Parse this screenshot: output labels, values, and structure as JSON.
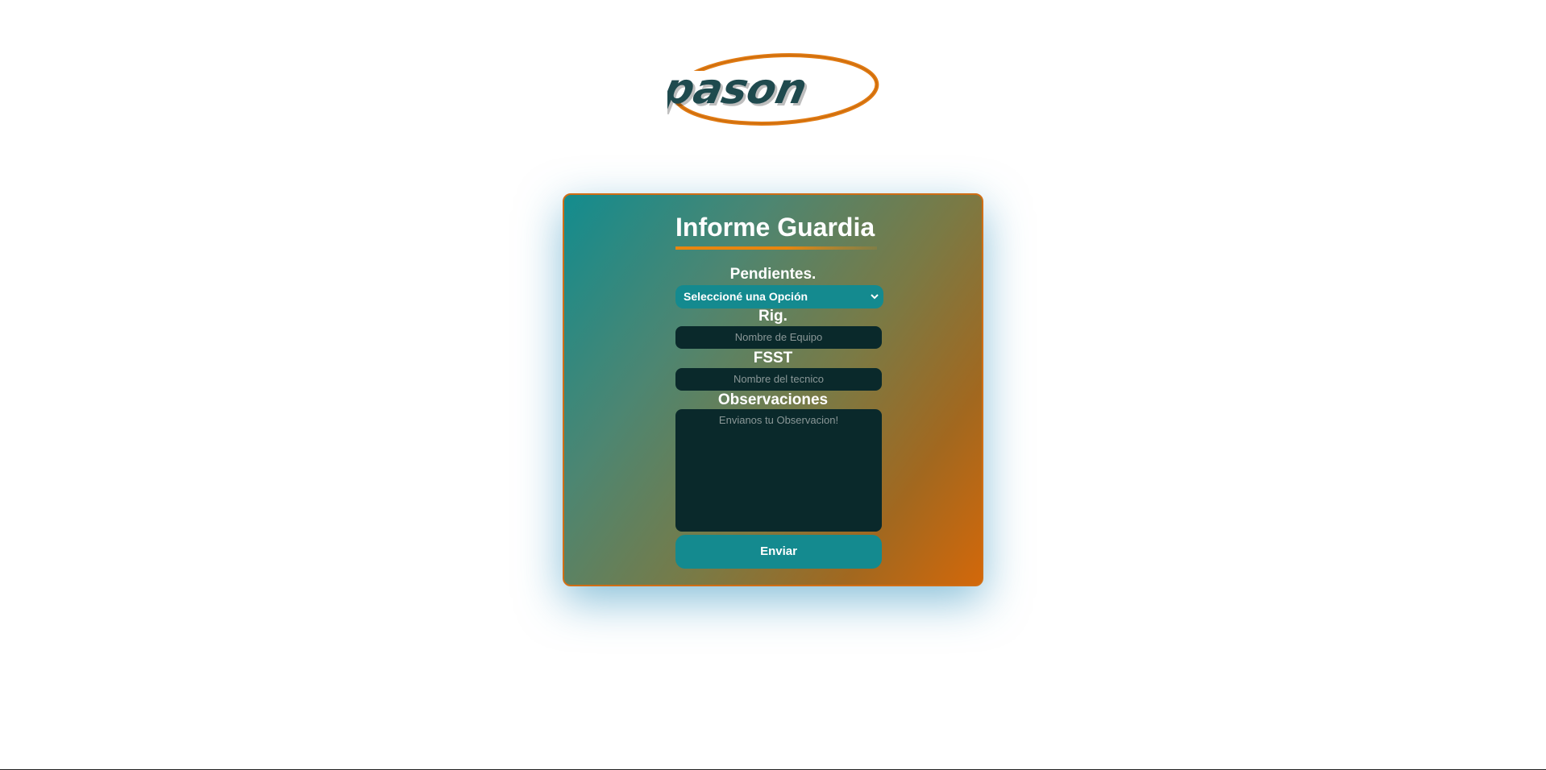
{
  "logo": {
    "text": "pason",
    "colors": {
      "text": "#1f4a4e",
      "ring": "#e07a12"
    }
  },
  "form": {
    "title": "Informe Guardia",
    "pendientes": {
      "label": "Pendientes.",
      "selected": "Seleccioné una Opción"
    },
    "rig": {
      "label": "Rig.",
      "placeholder": "Nombre de Equipo"
    },
    "fsst": {
      "label": "FSST",
      "placeholder": "Nombre del tecnico"
    },
    "observaciones": {
      "label": "Observaciones",
      "placeholder": "Envianos tu Observacion!"
    },
    "submit_label": "Enviar"
  },
  "colors": {
    "accent_teal": "#148a8f",
    "accent_orange": "#d06e15",
    "field_dark": "#0a292b"
  }
}
